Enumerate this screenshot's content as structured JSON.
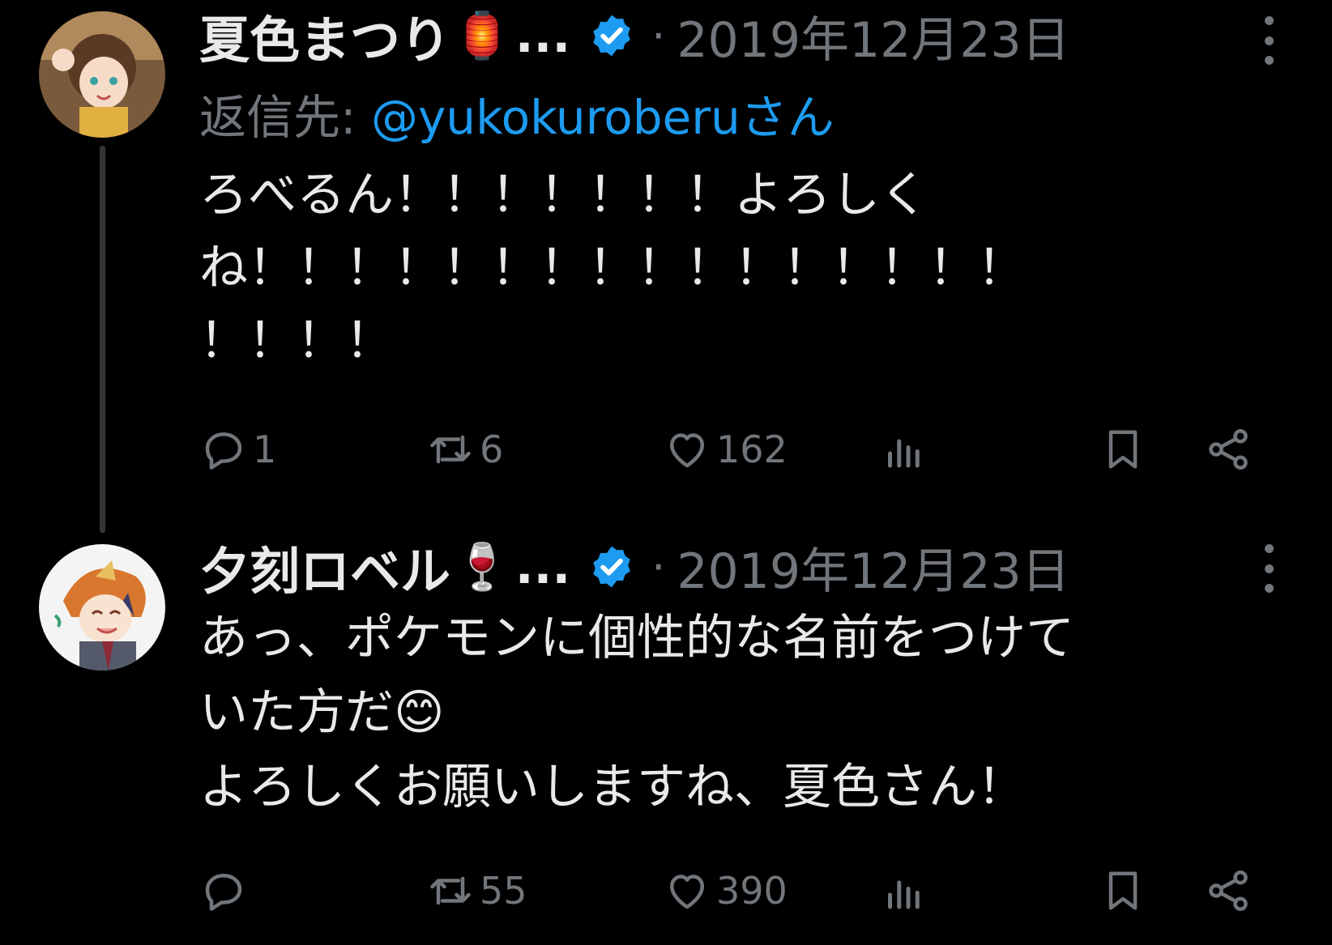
{
  "tweets": [
    {
      "author": "夏色まつり",
      "name_emoji": "🏮",
      "ellipsis": "...",
      "separator": "·",
      "date": "2019年12月23日",
      "reply_prefix": "返信先:",
      "reply_handle": "@yukokuroberuさん",
      "text": "ろべるん！！！！！！！よろしく\nね！！！！！！！！！！！！！！！！\n！！！！",
      "actions": {
        "replies": "1",
        "retweets": "6",
        "likes": "162"
      },
      "avatar_colors": {
        "bg": "#8a6a4a",
        "hair": "#6b4a2e",
        "face": "#f6dcc8"
      }
    },
    {
      "author": "夕刻ロベル",
      "name_emoji": "🍷",
      "ellipsis": "...",
      "separator": "·",
      "date": "2019年12月23日",
      "text": "あっ、ポケモンに個性的な名前をつけて\nいた方だ😊\nよろしくお願いしますね、夏色さん！",
      "actions": {
        "replies": "",
        "retweets": "55",
        "likes": "390"
      },
      "avatar_colors": {
        "bg": "#f2f2f2",
        "hair": "#d9772e",
        "face": "#f8e2d0"
      }
    }
  ],
  "colors": {
    "background": "#000000",
    "text": "#e7e9ea",
    "muted": "#71767b",
    "link": "#1d9bf0",
    "verified": "#1d9bf0"
  },
  "icons": [
    "reply-icon",
    "retweet-icon",
    "like-icon",
    "views-icon",
    "bookmark-icon",
    "share-icon",
    "verified-badge-icon",
    "more-icon"
  ]
}
